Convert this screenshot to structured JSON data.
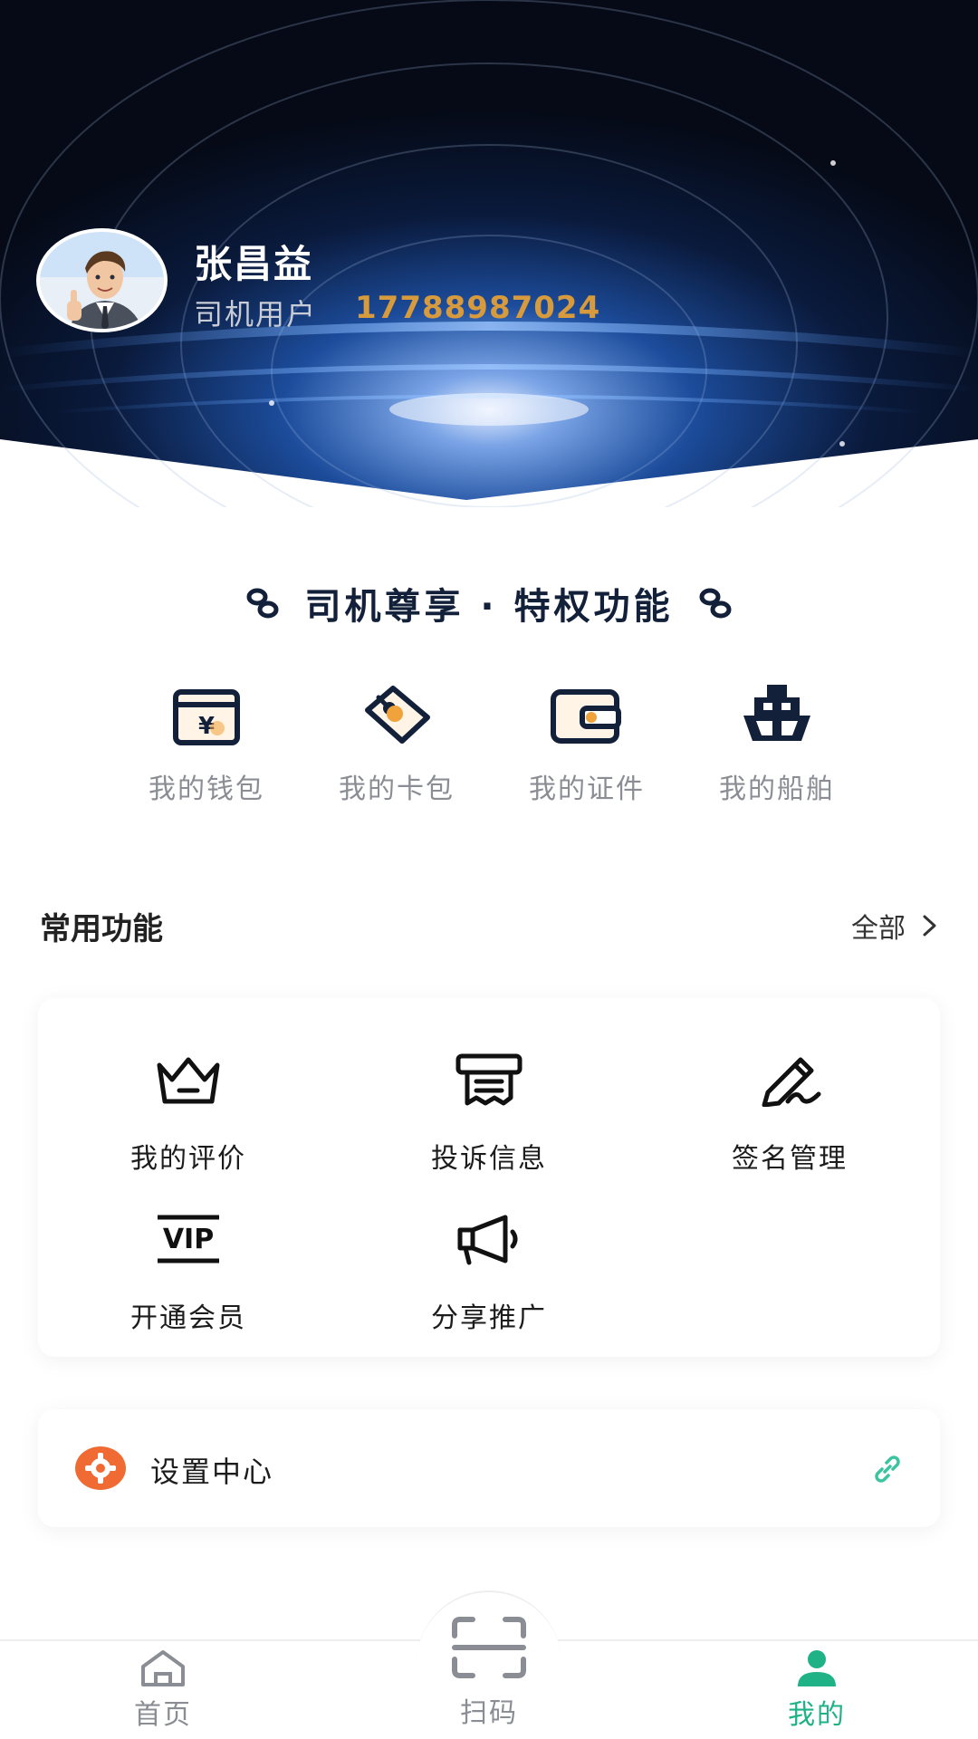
{
  "profile": {
    "name": "张昌益",
    "role": "司机用户",
    "phone": "17788987024"
  },
  "privileges": {
    "title": "司机尊享 · 特权功能",
    "items": [
      {
        "label": "我的钱包",
        "icon": "wallet-yen-icon"
      },
      {
        "label": "我的卡包",
        "icon": "card-tag-icon"
      },
      {
        "label": "我的证件",
        "icon": "credential-wallet-icon"
      },
      {
        "label": "我的船舶",
        "icon": "ship-icon"
      }
    ]
  },
  "common": {
    "title": "常用功能",
    "see_all": "全部",
    "items": [
      {
        "label": "我的评价",
        "icon": "crown-icon"
      },
      {
        "label": "投诉信息",
        "icon": "receipt-icon"
      },
      {
        "label": "签名管理",
        "icon": "pen-signature-icon"
      },
      {
        "label": "开通会员",
        "icon": "vip-icon"
      },
      {
        "label": "分享推广",
        "icon": "megaphone-icon"
      }
    ]
  },
  "settings": {
    "label": "设置中心",
    "icon": "gear-icon"
  },
  "nav": {
    "items": [
      {
        "label": "首页",
        "icon": "home-icon"
      },
      {
        "label": "扫码",
        "icon": "scan-icon"
      },
      {
        "label": "我的",
        "icon": "user-icon"
      }
    ],
    "active_index": 2
  },
  "colors": {
    "accent": "#1fb287",
    "phone": "#d79a3c",
    "privilege_icon": "#13203a",
    "privilege_icon_accent": "#f0a33a"
  }
}
